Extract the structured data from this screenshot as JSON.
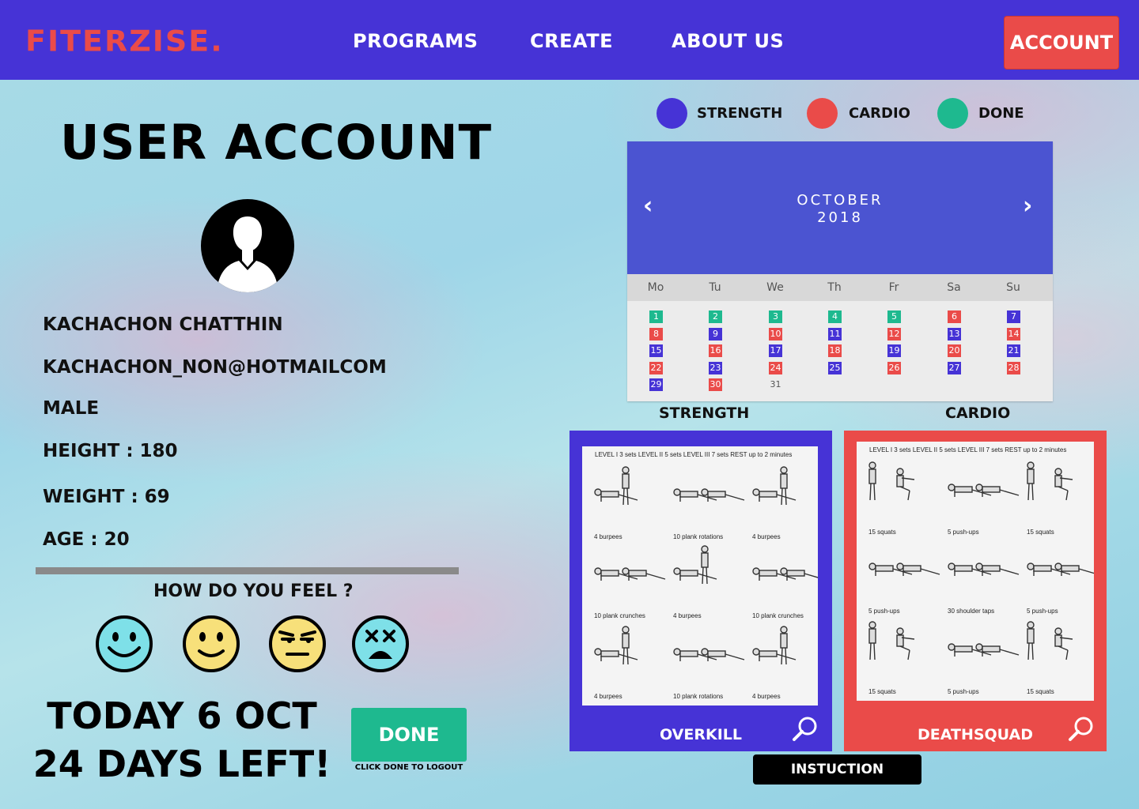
{
  "nav": {
    "logo": "FITERZISE.",
    "links": [
      "PROGRAMS",
      "CREATE",
      "ABOUT US"
    ],
    "account_label": "ACCOUNT"
  },
  "profile": {
    "title": "USER ACCOUNT",
    "name": "KACHACHON CHATTHIN",
    "email": "KACHACHON_NON@HOTMAILCOM",
    "gender": "MALE",
    "height": "HEIGHT : 180",
    "weight": "WEIGHT : 69",
    "age": "AGE : 20"
  },
  "feel": {
    "question": "HOW DO YOU FEEL ?",
    "moods": [
      "happy-face-icon",
      "smile-face-icon",
      "annoyed-face-icon",
      "dizzy-face-icon"
    ]
  },
  "status": {
    "today": "TODAY 6 OCT",
    "days_left": "24 DAYS LEFT!",
    "done_label": "DONE",
    "done_hint": "CLICK DONE TO LOGOUT"
  },
  "legend": [
    {
      "label": "STRENGTH",
      "color": "#4633d6"
    },
    {
      "label": "CARDIO",
      "color": "#ea4b49"
    },
    {
      "label": "DONE",
      "color": "#1eb98f"
    }
  ],
  "calendar": {
    "month": "OCTOBER",
    "year": "2018",
    "weekdays": [
      "Mo",
      "Tu",
      "We",
      "Th",
      "Fr",
      "Sa",
      "Su"
    ],
    "days": [
      {
        "d": "1",
        "t": "done"
      },
      {
        "d": "2",
        "t": "done"
      },
      {
        "d": "3",
        "t": "done"
      },
      {
        "d": "4",
        "t": "done"
      },
      {
        "d": "5",
        "t": "done"
      },
      {
        "d": "6",
        "t": "cardio"
      },
      {
        "d": "7",
        "t": "strength"
      },
      {
        "d": "8",
        "t": "cardio"
      },
      {
        "d": "9",
        "t": "strength"
      },
      {
        "d": "10",
        "t": "cardio"
      },
      {
        "d": "11",
        "t": "strength"
      },
      {
        "d": "12",
        "t": "cardio"
      },
      {
        "d": "13",
        "t": "strength"
      },
      {
        "d": "14",
        "t": "cardio"
      },
      {
        "d": "15",
        "t": "strength"
      },
      {
        "d": "16",
        "t": "cardio"
      },
      {
        "d": "17",
        "t": "strength"
      },
      {
        "d": "18",
        "t": "cardio"
      },
      {
        "d": "19",
        "t": "strength"
      },
      {
        "d": "20",
        "t": "cardio"
      },
      {
        "d": "21",
        "t": "strength"
      },
      {
        "d": "22",
        "t": "cardio"
      },
      {
        "d": "23",
        "t": "strength"
      },
      {
        "d": "24",
        "t": "cardio"
      },
      {
        "d": "25",
        "t": "strength"
      },
      {
        "d": "26",
        "t": "cardio"
      },
      {
        "d": "27",
        "t": "strength"
      },
      {
        "d": "28",
        "t": "cardio"
      },
      {
        "d": "29",
        "t": "strength"
      },
      {
        "d": "30",
        "t": "cardio"
      },
      {
        "d": "31",
        "t": "none"
      }
    ]
  },
  "programs": {
    "strength_caption": "STRENGTH",
    "cardio_caption": "CARDIO",
    "strength": {
      "name": "OVERKILL",
      "levels": "LEVEL I 3 sets  LEVEL II 5 sets  LEVEL III 7 sets  REST up to 2 minutes",
      "exercises": [
        "4 burpees",
        "10 plank rotations",
        "4 burpees",
        "10 plank crunches",
        "4 burpees",
        "10 plank crunches",
        "4 burpees",
        "10 plank rotations",
        "4 burpees"
      ]
    },
    "cardio": {
      "name": "DEATHSQUAD",
      "levels": "LEVEL I 3 sets  LEVEL II 5 sets  LEVEL III 7 sets  REST up to 2 minutes",
      "exercises": [
        "15 squats",
        "5 push-ups",
        "15 squats",
        "5 push-ups",
        "30 shoulder taps",
        "5 push-ups",
        "15 squats",
        "5 push-ups",
        "15 squats"
      ]
    },
    "instruction_label": "INSTUCTION"
  },
  "colors": {
    "strength": "#4633d6",
    "cardio": "#ea4b49",
    "done": "#1eb98f",
    "nav": "#4633d6"
  }
}
